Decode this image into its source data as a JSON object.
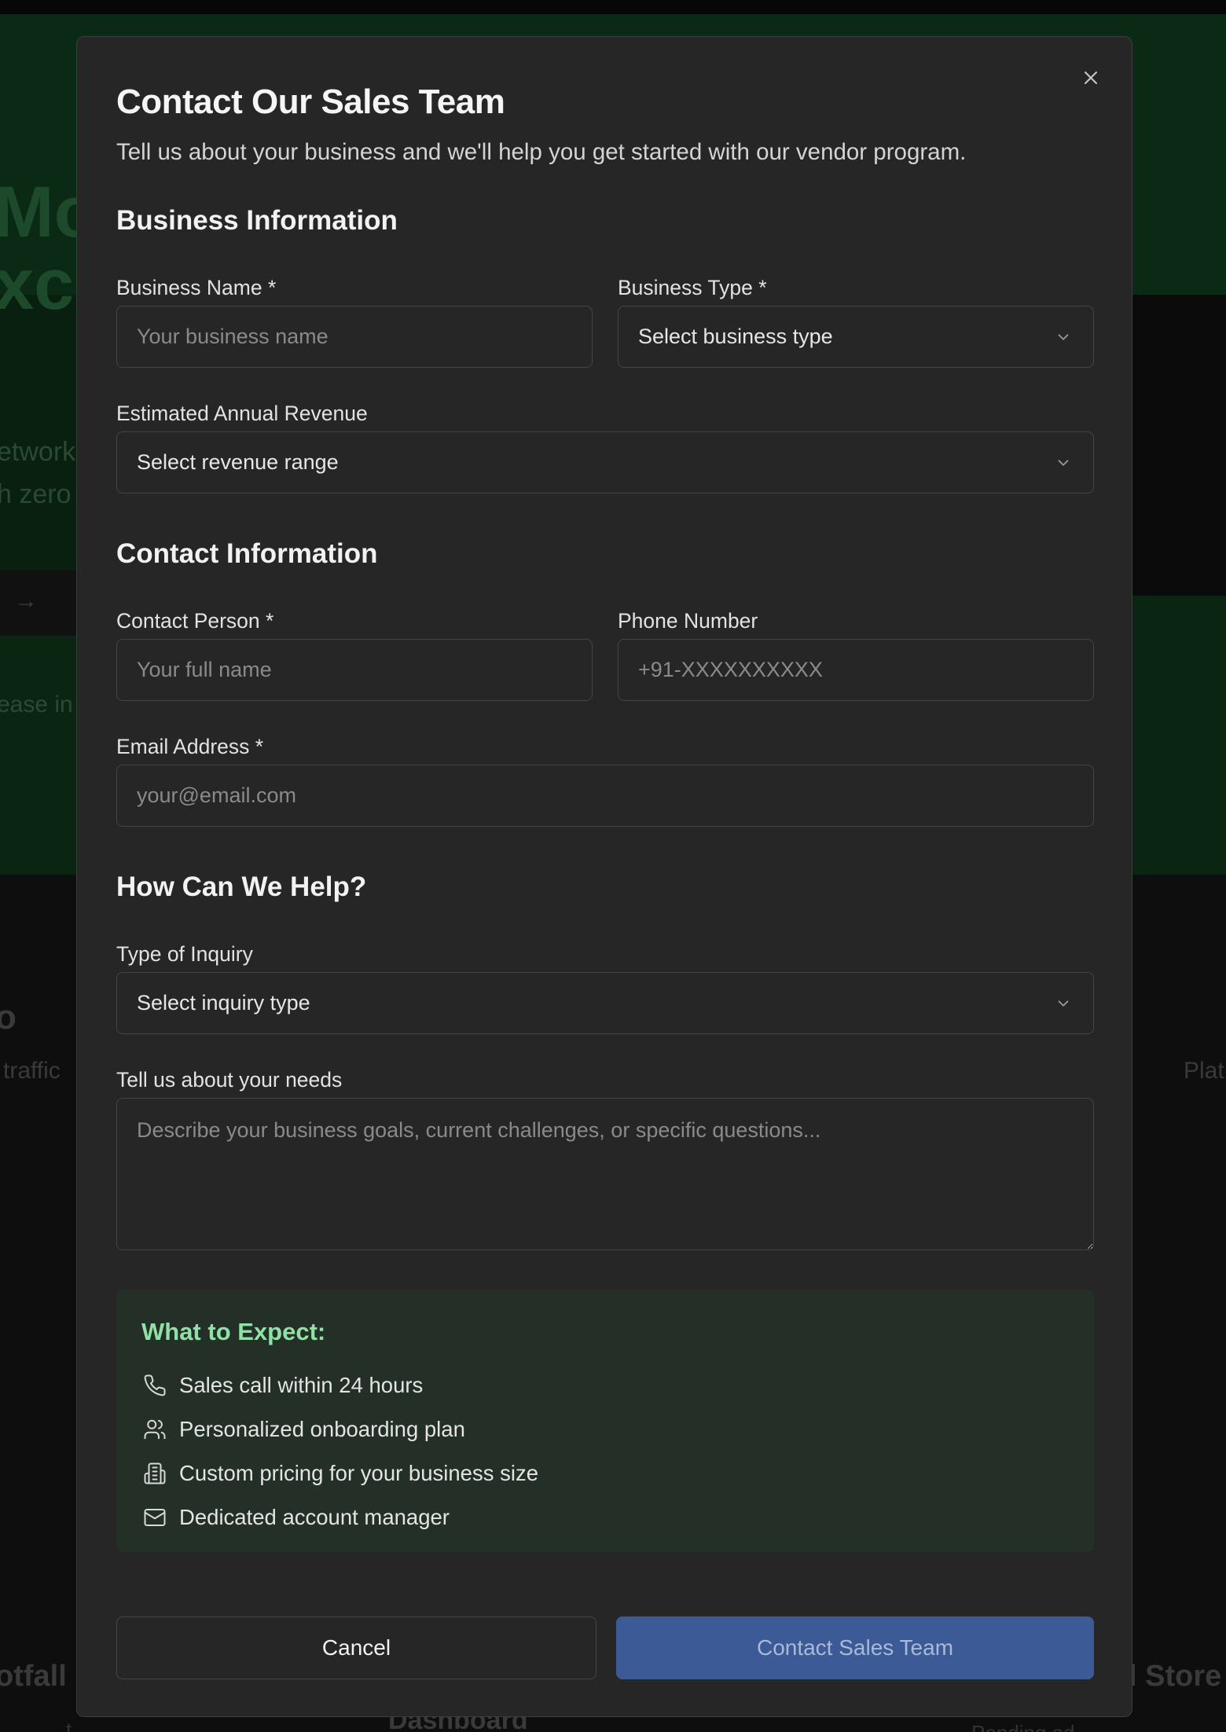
{
  "background": {
    "hero_line_1": "Mor",
    "hero_line_2": "xcl",
    "subtext_1": "etwork",
    "subtext_2": "h zero",
    "arrow": "→",
    "notice": "ease in",
    "heading_fragment": "o",
    "traffic": "traffic",
    "platform": "Plat",
    "footfall": "otfall",
    "dashboard": "Dashboard",
    "store": "l Store",
    "pending": "Pending ad",
    "dot": "t"
  },
  "modal": {
    "title": "Contact Our Sales Team",
    "description": "Tell us about your business and we'll help you get started with our vendor program.",
    "close_icon": "close-icon"
  },
  "business_section": {
    "title": "Business Information",
    "business_name": {
      "label": "Business Name *",
      "placeholder": "Your business name",
      "value": ""
    },
    "business_type": {
      "label": "Business Type *",
      "value": "Select business type"
    },
    "annual_revenue": {
      "label": "Estimated Annual Revenue",
      "value": "Select revenue range"
    }
  },
  "contact_section": {
    "title": "Contact Information",
    "contact_person": {
      "label": "Contact Person *",
      "placeholder": "Your full name",
      "value": ""
    },
    "phone": {
      "label": "Phone Number",
      "placeholder": "+91-XXXXXXXXXX",
      "value": ""
    },
    "email": {
      "label": "Email Address *",
      "placeholder": "your@email.com",
      "value": ""
    }
  },
  "help_section": {
    "title": "How Can We Help?",
    "inquiry_type": {
      "label": "Type of Inquiry",
      "value": "Select inquiry type"
    },
    "needs": {
      "label": "Tell us about your needs",
      "placeholder": "Describe your business goals, current challenges, or specific questions...",
      "value": ""
    }
  },
  "expect": {
    "title": "What to Expect:",
    "items": [
      {
        "icon": "phone-icon",
        "text": "Sales call within 24 hours"
      },
      {
        "icon": "users-icon",
        "text": "Personalized onboarding plan"
      },
      {
        "icon": "building-icon",
        "text": "Custom pricing for your business size"
      },
      {
        "icon": "mail-icon",
        "text": "Dedicated account manager"
      }
    ]
  },
  "actions": {
    "cancel_label": "Cancel",
    "submit_label": "Contact Sales Team"
  },
  "colors": {
    "modal_bg": "#262626",
    "accent_button": "#3b5a96",
    "expect_title": "#8fe1a5",
    "expect_bg": "#232f27"
  }
}
